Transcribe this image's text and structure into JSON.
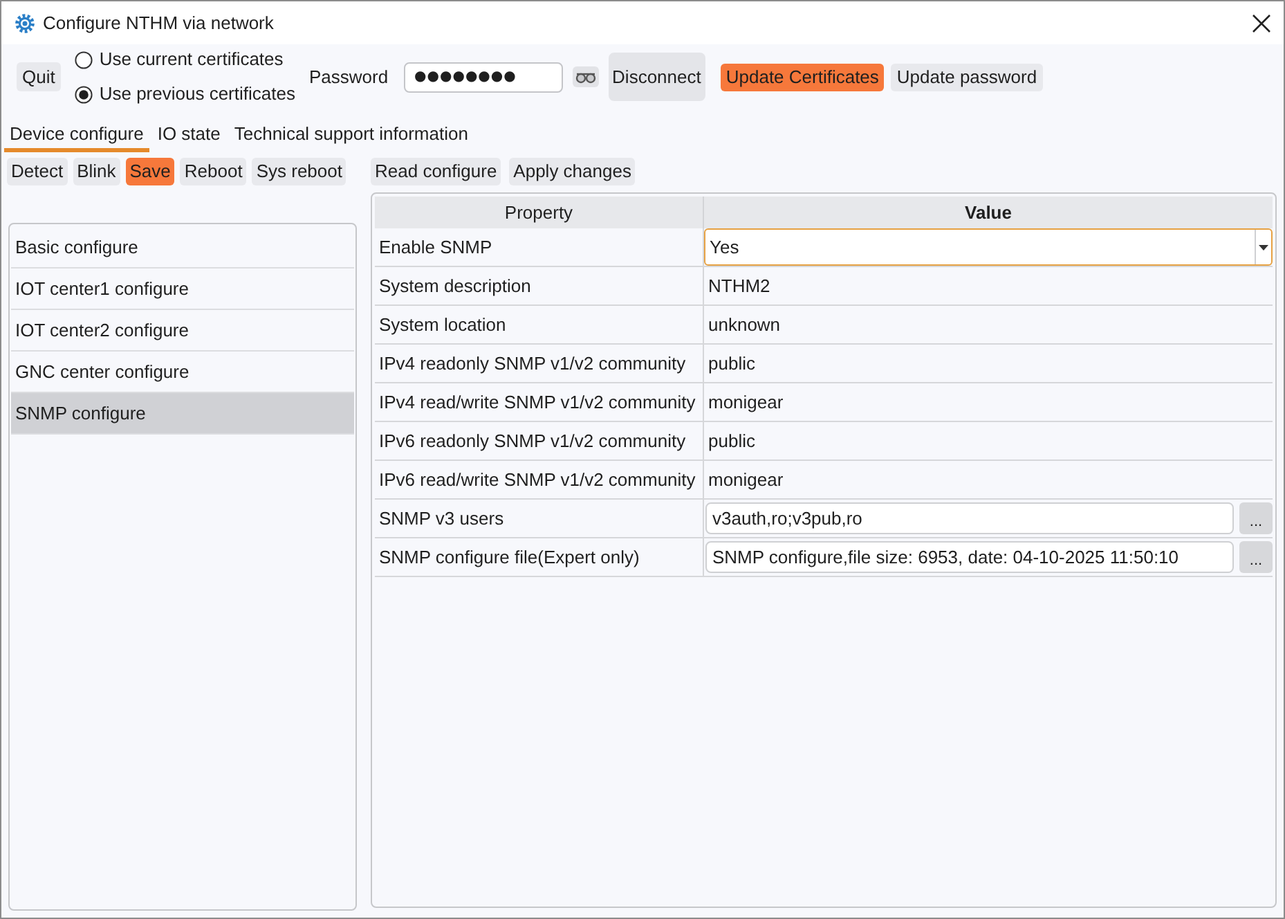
{
  "window": {
    "title": "Configure NTHM via network"
  },
  "toolbar": {
    "quit": "Quit",
    "certificate_options": [
      {
        "label": "Use current certificates",
        "selected": false
      },
      {
        "label": "Use previous certificates",
        "selected": true
      }
    ],
    "password": {
      "label": "Password",
      "value": "●●●●●●●●"
    },
    "buttons": [
      {
        "label": "Disconnect",
        "kind": "large"
      },
      {
        "label": "Update Certificates",
        "kind": "accent"
      },
      {
        "label": "Update password",
        "kind": "plain"
      }
    ]
  },
  "tabs": [
    {
      "label": "Device configure",
      "selected": true
    },
    {
      "label": "IO state",
      "selected": false
    },
    {
      "label": "Technical support information",
      "selected": false
    }
  ],
  "device_buttons": [
    {
      "label": "Detect",
      "kind": "plain"
    },
    {
      "label": "Blink",
      "kind": "plain"
    },
    {
      "label": "Save",
      "kind": "accent"
    },
    {
      "label": "Reboot",
      "kind": "plain"
    },
    {
      "label": "Sys reboot",
      "kind": "plain"
    }
  ],
  "config_buttons": [
    {
      "label": "Read configure",
      "kind": "plain"
    },
    {
      "label": "Apply changes",
      "kind": "plain"
    }
  ],
  "sidebar": {
    "items": [
      {
        "label": "Basic configure",
        "selected": false
      },
      {
        "label": "IOT center1 configure",
        "selected": false
      },
      {
        "label": "IOT center2 configure",
        "selected": false
      },
      {
        "label": "GNC center configure",
        "selected": false
      },
      {
        "label": "SNMP configure",
        "selected": true
      }
    ]
  },
  "table": {
    "columns": [
      {
        "label": "Property",
        "bold": false
      },
      {
        "label": "Value",
        "bold": true
      }
    ],
    "rows": [
      {
        "property": "Enable SNMP",
        "value": "Yes",
        "kind": "dropdown",
        "focused": true
      },
      {
        "property": "System description",
        "value": "NTHM2",
        "kind": "text",
        "focused": false
      },
      {
        "property": "System location",
        "value": "unknown",
        "kind": "text",
        "focused": false
      },
      {
        "property": "IPv4 readonly SNMP v1/v2 community",
        "value": "public",
        "kind": "text",
        "focused": false
      },
      {
        "property": "IPv4 read/write SNMP v1/v2 community",
        "value": "monigear",
        "kind": "text",
        "focused": false
      },
      {
        "property": "IPv6 readonly SNMP v1/v2 community",
        "value": "public",
        "kind": "text",
        "focused": false
      },
      {
        "property": "IPv6 read/write SNMP v1/v2 community",
        "value": "monigear",
        "kind": "text",
        "focused": false
      },
      {
        "property": "SNMP v3 users",
        "value": "v3auth,ro;v3pub,ro",
        "kind": "browse",
        "button": "...",
        "focused": false
      },
      {
        "property": "SNMP configure file(Expert only)",
        "value": "SNMP configure,file size: 6953, date: 04-10-2025 11:50:10",
        "kind": "browse",
        "button": "...",
        "focused": false
      }
    ]
  }
}
